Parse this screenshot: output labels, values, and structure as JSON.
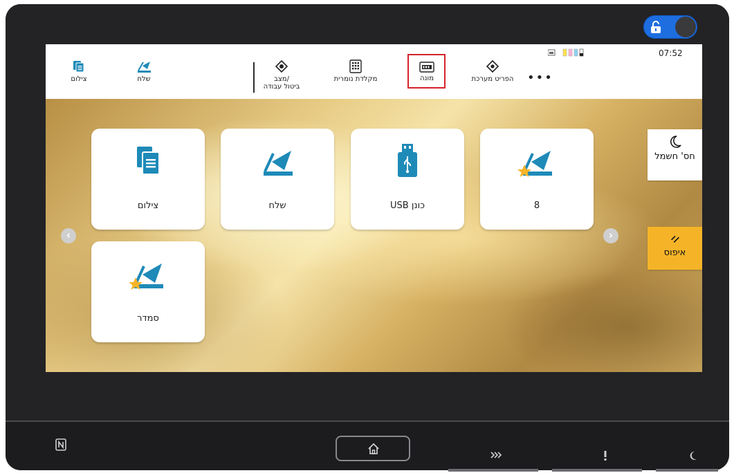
{
  "topbar": {
    "items": [
      {
        "label": "צילום",
        "icon": "copy-icon"
      },
      {
        "label": "שלח",
        "icon": "send-icon"
      },
      {
        "label_line1": "מצב/",
        "label_line2": "ביטול עבודה",
        "icon": "job-status-icon"
      },
      {
        "label": "מקלדת נומרית",
        "icon": "numeric-keypad-icon"
      },
      {
        "label": "מונה",
        "icon": "counter-icon"
      },
      {
        "label": "הפריט מערכת",
        "icon": "system-menu-icon"
      }
    ],
    "more": "•••",
    "clock": "07:52"
  },
  "tiles": [
    {
      "label": "צילום",
      "icon": "copy-icon"
    },
    {
      "label": "שלח",
      "icon": "send-icon"
    },
    {
      "label": "USB כונן",
      "icon": "usb-drive-icon"
    },
    {
      "label": "8",
      "icon": "send-favorite-icon"
    },
    {
      "label": "סמדר",
      "icon": "send-favorite-icon"
    }
  ],
  "side": {
    "power_save": "חס' חשמל",
    "reset": "איפוס"
  },
  "colors": {
    "accent_blue": "#1e8ab8",
    "star": "#f5b428",
    "toggle": "#1e6ee0",
    "highlight": "#d4222b"
  }
}
